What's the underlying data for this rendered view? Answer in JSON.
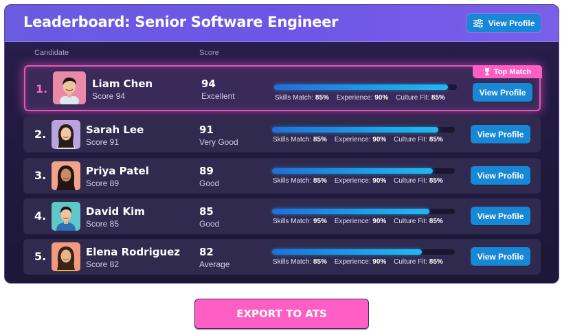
{
  "header": {
    "title": "Leaderboard: Senior Software Engineer",
    "button_label": "View Profile",
    "button_icon": "sliders-icon"
  },
  "columns": {
    "candidate": "Candidate",
    "score": "Score"
  },
  "colors": {
    "accent_pink": "#ff5fc4",
    "button_blue": "#1787d6",
    "header_purple": "#6d56e6",
    "card_bg": "#221a42"
  },
  "candidates": [
    {
      "rank": "1.",
      "name": "Liam Chen",
      "sub": "Score 94",
      "score": "94",
      "rating": "Excellent",
      "progress": 0.95,
      "metrics": {
        "skills_label": "Skills Match:",
        "skills": "85%",
        "experience_label": "Experience:",
        "experience": "90%",
        "culture_label": "Culture Fit:",
        "culture": "85%"
      },
      "button": "View Profile",
      "badge": "Top Match"
    },
    {
      "rank": "2.",
      "name": "Sarah Lee",
      "sub": "Score 91",
      "score": "91",
      "rating": "Very Good",
      "progress": 0.91,
      "metrics": {
        "skills_label": "Skills Match:",
        "skills": "85%",
        "experience_label": "Experience:",
        "experience": "90%",
        "culture_label": "Culture Fit:",
        "culture": "85%"
      },
      "button": "View Profile"
    },
    {
      "rank": "3.",
      "name": "Priya Patel",
      "sub": "Score 89",
      "score": "89",
      "rating": "Good",
      "progress": 0.88,
      "metrics": {
        "skills_label": "Skills Match:",
        "skills": "85%",
        "experience_label": "Experience:",
        "experience": "90%",
        "culture_label": "Culture Fit:",
        "culture": "85%"
      },
      "button": "View Profile"
    },
    {
      "rank": "4.",
      "name": "David Kim",
      "sub": "Score 85",
      "score": "85",
      "rating": "Good",
      "progress": 0.86,
      "metrics": {
        "skills_label": "Skills Match:",
        "skills": "95%",
        "experience_label": "Experience:",
        "experience": "90%",
        "culture_label": "Culture Fit:",
        "culture": "85%"
      },
      "button": "View Profile"
    },
    {
      "rank": "5.",
      "name": "Elena Rodriguez",
      "sub": "Score 82",
      "score": "82",
      "rating": "Average",
      "progress": 0.82,
      "metrics": {
        "skills_label": "Skills Match:",
        "skills": "85%",
        "experience_label": "Experience:",
        "experience": "90%",
        "culture_label": "Culture Fit:",
        "culture": "85%"
      },
      "button": "View Profile"
    }
  ],
  "export_button": "EXPORT TO ATS"
}
